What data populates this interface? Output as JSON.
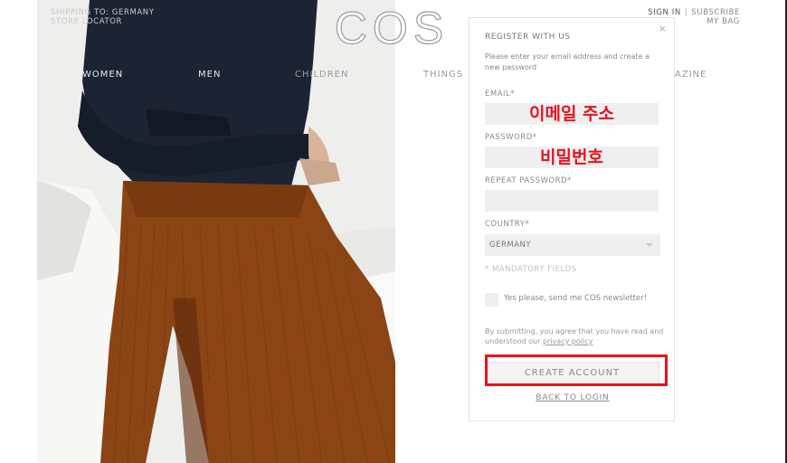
{
  "header": {
    "shipping": "SHIPPING TO: GERMANY",
    "store_locator": "STORE LOCATOR",
    "sign_in": "SIGN IN",
    "separator": "|",
    "subscribe": "SUBSCRIBE",
    "my_bag": "MY BAG",
    "logo": "COS"
  },
  "nav": {
    "women": "WOMEN",
    "men": "MEN",
    "children": "CHILDREN",
    "things": "THINGS",
    "magazine": "AZINE"
  },
  "register": {
    "title": "REGISTER WITH US",
    "description": "Please enter your email address and create a new password",
    "close": "×",
    "email_label": "EMAIL*",
    "email_overlay": "이메일 주소",
    "password_label": "PASSWORD*",
    "password_overlay": "비밀번호",
    "repeat_label": "REPEAT PASSWORD*",
    "country_label": "COUNTRY*",
    "country_value": "GERMANY",
    "mandatory": "* MANDATORY FIELDS",
    "newsletter": "Yes please, send me COS newsletter!",
    "agree_text": "By submitting, you agree that you have read and understood our",
    "privacy_link": "privacy policy",
    "create_button": "CREATE ACCOUNT",
    "back_to_login": "BACK TO LOGIN"
  },
  "colors": {
    "annotation_red": "#e8121d",
    "sweater": "#1c2433",
    "trousers": "#8b4414"
  }
}
